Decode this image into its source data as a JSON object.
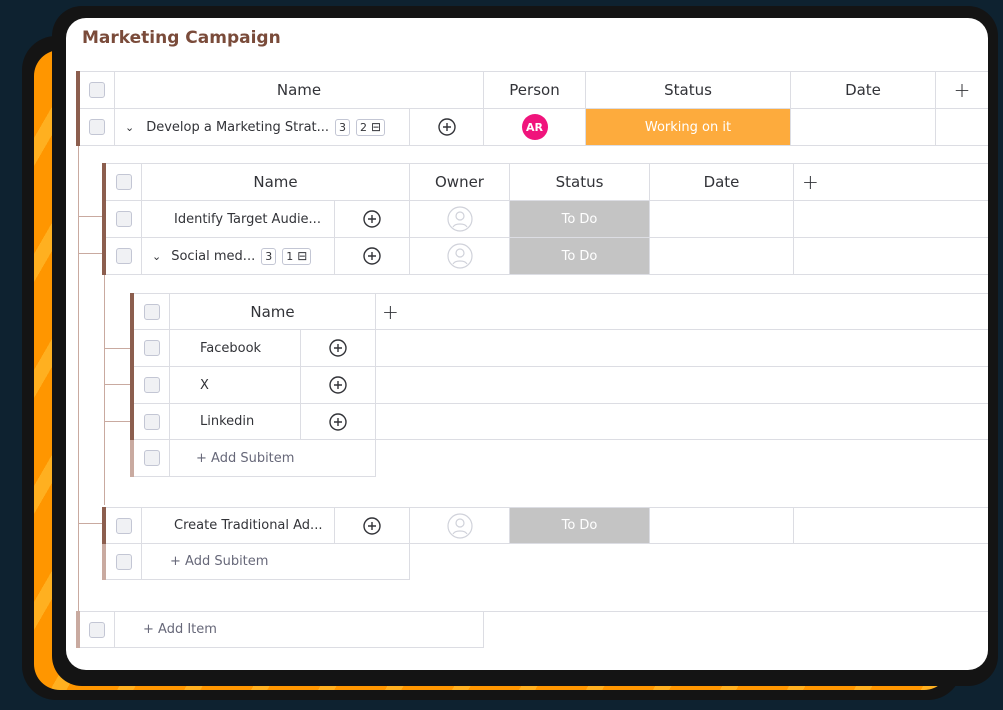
{
  "board": {
    "title": "Marketing Campaign",
    "columns": {
      "name": "Name",
      "person": "Person",
      "status": "Status",
      "date": "Date",
      "add": "+"
    },
    "item": {
      "name": "Develop a Marketing Strat...",
      "updates_count": "3",
      "subitems_count": "2",
      "person_initials": "AR",
      "status": "Working on it"
    },
    "subtable": {
      "columns": {
        "name": "Name",
        "owner": "Owner",
        "status": "Status",
        "date": "Date",
        "add": "+"
      },
      "rows": [
        {
          "name": "Identify Target Audie...",
          "status": "To Do"
        },
        {
          "name": "Social med...",
          "updates_count": "3",
          "subitems_count": "1",
          "status": "To Do"
        },
        {
          "name": "Create Traditional Ad...",
          "status": "To Do"
        }
      ],
      "add_subitem": "+ Add Subitem"
    },
    "subsubtable": {
      "columns": {
        "name": "Name",
        "add": "+"
      },
      "rows": [
        {
          "name": "Facebook"
        },
        {
          "name": "X"
        },
        {
          "name": "Linkedin"
        }
      ],
      "add_subitem": "+ Add Subitem"
    },
    "add_item": "+ Add Item"
  },
  "colors": {
    "accent_bar": "#8c5e4e",
    "working": "#fdab3d",
    "todo": "#c4c4c4",
    "avatar": "#f0147c",
    "title": "#7a4b3a"
  }
}
